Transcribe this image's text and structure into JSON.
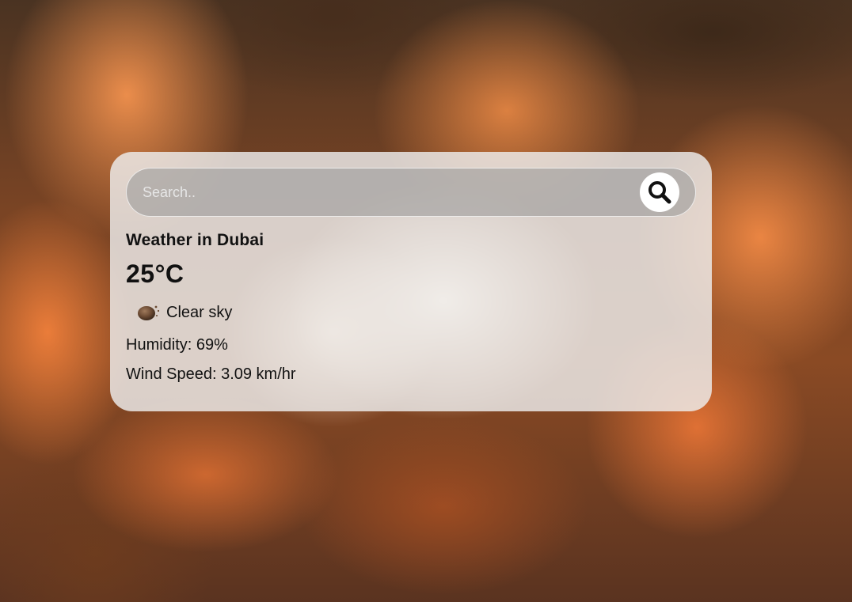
{
  "search": {
    "placeholder": "Search..",
    "button_icon": "search-icon"
  },
  "weather": {
    "city_label": "Weather in Dubai",
    "temperature": "25°C",
    "icon": "clear-sky-icon",
    "description": "Clear sky",
    "humidity": "Humidity: 69%",
    "wind_speed": "Wind Speed: 3.09 km/hr"
  },
  "colors": {
    "card_background": "#eeeeee",
    "search_background": "#969696",
    "text": "#111111"
  }
}
